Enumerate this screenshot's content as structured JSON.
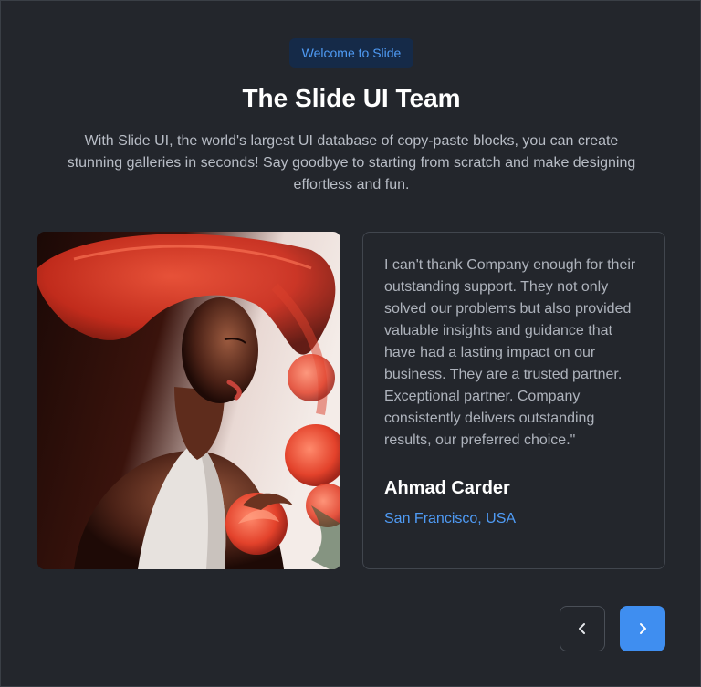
{
  "header": {
    "badge": "Welcome to Slide",
    "title": "The Slide UI Team",
    "description": "With Slide UI, the world's largest UI database of copy-paste blocks, you can create stunning galleries in seconds! Say goodbye to starting from scratch and make designing effortless and fun."
  },
  "testimonial": {
    "quote": "I can't thank Company enough for their outstanding support. They not only solved our problems but also provided valuable insights and guidance that have had a lasting impact on our business. They are a trusted partner. Exceptional partner. Company consistently delivers outstanding results, our preferred choice.\"",
    "author": "Ahmad Carder",
    "location": "San Francisco, USA"
  },
  "navigation": {
    "prev_icon": "chevron-left-icon",
    "next_icon": "chevron-right-icon"
  },
  "colors": {
    "background": "#23262c",
    "accent": "#3f8ef0",
    "badge_bg": "#152a48",
    "link": "#4f9bf5"
  }
}
